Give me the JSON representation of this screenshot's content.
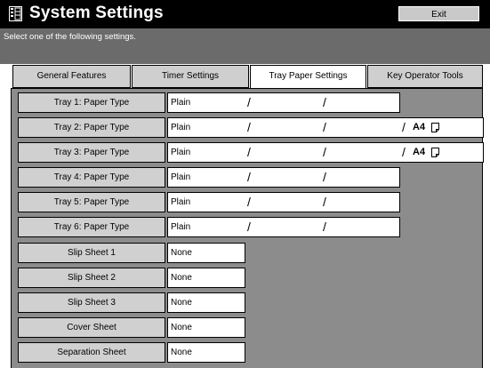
{
  "title": "System Settings",
  "exit_label": "Exit",
  "instruction": "Select one of the following settings.",
  "tabs": [
    {
      "label": "General Features",
      "active": false
    },
    {
      "label": "Timer Settings",
      "active": false
    },
    {
      "label": "Tray Paper Settings",
      "active": true
    },
    {
      "label": "Key Operator Tools",
      "active": false
    }
  ],
  "rows": [
    {
      "label": "Tray 1: Paper Type",
      "value": "Plain",
      "mark1": "/",
      "mark2": "/",
      "mark3": "",
      "size": "",
      "icon": ""
    },
    {
      "label": "Tray 2: Paper Type",
      "value": "Plain",
      "mark1": "/",
      "mark2": "/",
      "mark3": "/",
      "size": "A4",
      "icon": "paper-orientation-icon"
    },
    {
      "label": "Tray 3: Paper Type",
      "value": "Plain",
      "mark1": "/",
      "mark2": "/",
      "mark3": "/",
      "size": "A4",
      "icon": "paper-orientation-icon"
    },
    {
      "label": "Tray 4: Paper Type",
      "value": "Plain",
      "mark1": "/",
      "mark2": "/",
      "mark3": "",
      "size": "",
      "icon": ""
    },
    {
      "label": "Tray 5: Paper Type",
      "value": "Plain",
      "mark1": "/",
      "mark2": "/",
      "mark3": "",
      "size": "",
      "icon": ""
    },
    {
      "label": "Tray 6: Paper Type",
      "value": "Plain",
      "mark1": "/",
      "mark2": "/",
      "mark3": "",
      "size": "",
      "icon": ""
    },
    {
      "label": "Slip Sheet 1",
      "value": "None"
    },
    {
      "label": "Slip Sheet 2",
      "value": "None"
    },
    {
      "label": "Slip Sheet 3",
      "value": "None"
    },
    {
      "label": "Cover Sheet",
      "value": "None"
    },
    {
      "label": "Separation Sheet",
      "value": "None"
    }
  ]
}
